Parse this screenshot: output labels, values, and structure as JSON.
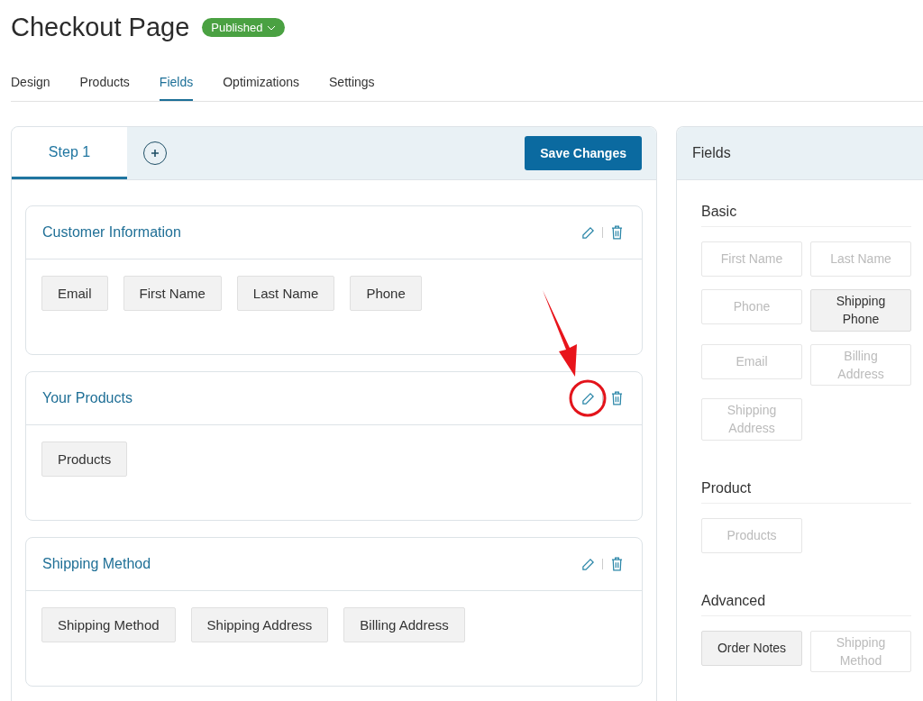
{
  "page": {
    "title": "Checkout Page",
    "status": "Published"
  },
  "tabs": [
    {
      "label": "Design",
      "selected": false
    },
    {
      "label": "Products",
      "selected": false
    },
    {
      "label": "Fields",
      "selected": true
    },
    {
      "label": "Optimizations",
      "selected": false
    },
    {
      "label": "Settings",
      "selected": false
    }
  ],
  "steps": [
    {
      "label": "Step 1",
      "selected": true
    }
  ],
  "save_button": "Save Changes",
  "sections": [
    {
      "title": "Customer Information",
      "highlighted": false,
      "fields": [
        "Email",
        "First Name",
        "Last Name",
        "Phone"
      ]
    },
    {
      "title": "Your Products",
      "highlighted": true,
      "fields": [
        "Products"
      ]
    },
    {
      "title": "Shipping Method",
      "highlighted": false,
      "fields": [
        "Shipping Method",
        "Shipping Address",
        "Billing Address"
      ]
    }
  ],
  "fields_panel": {
    "title": "Fields",
    "groups": [
      {
        "title": "Basic",
        "items": [
          {
            "label": "First Name",
            "disabled": true
          },
          {
            "label": "Last Name",
            "disabled": true
          },
          {
            "label": "Phone",
            "disabled": true
          },
          {
            "label": "Shipping Phone",
            "disabled": false
          },
          {
            "label": "Email",
            "disabled": true
          },
          {
            "label": "Billing Address",
            "disabled": true
          },
          {
            "label": "Shipping Address",
            "disabled": true
          }
        ]
      },
      {
        "title": "Product",
        "items": [
          {
            "label": "Products",
            "disabled": true
          }
        ]
      },
      {
        "title": "Advanced",
        "items": [
          {
            "label": "Order Notes",
            "disabled": false
          },
          {
            "label": "Shipping Method",
            "disabled": true
          }
        ]
      }
    ]
  }
}
